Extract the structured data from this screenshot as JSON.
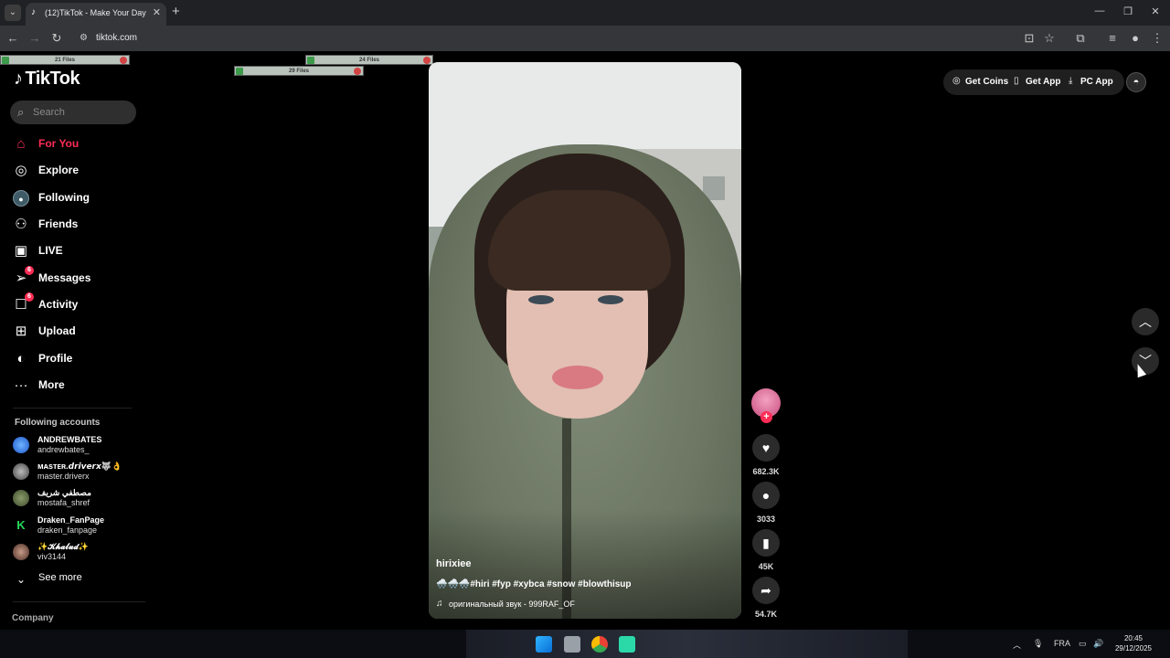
{
  "browser": {
    "tab_title": "(12)TikTok - Make Your Day",
    "url": "tiktok.com"
  },
  "file_bars": [
    "21 Files",
    "24 Files",
    "29 Files"
  ],
  "sidebar": {
    "logo": "TikTok",
    "search_placeholder": "Search",
    "nav": [
      {
        "label": "For You",
        "icon": "home-icon",
        "active": true
      },
      {
        "label": "Explore",
        "icon": "compass-icon"
      },
      {
        "label": "Following",
        "icon": "following-avatar-icon"
      },
      {
        "label": "Friends",
        "icon": "friends-icon"
      },
      {
        "label": "LIVE",
        "icon": "live-icon"
      },
      {
        "label": "Messages",
        "icon": "messages-icon",
        "badge": "6"
      },
      {
        "label": "Activity",
        "icon": "activity-icon",
        "badge": "6"
      },
      {
        "label": "Upload",
        "icon": "upload-icon"
      },
      {
        "label": "Profile",
        "icon": "profile-icon"
      },
      {
        "label": "More",
        "icon": "more-icon"
      }
    ],
    "following_title": "Following accounts",
    "accounts": [
      {
        "name": "ANDREWBATES",
        "handle": "andrewbates_"
      },
      {
        "name": "ᴍᴀsᴛᴇʀ.𝙙𝙧𝙞𝙫𝙚𝙧𝙭🐺👌",
        "handle": "master.driverx"
      },
      {
        "name": "مصطفي شريف",
        "handle": "mostafa_shref"
      },
      {
        "name": "Draken_FanPage",
        "handle": "draken_fanpage"
      },
      {
        "name": "✨𝓚𝓱𝓪𝓵𝓾𝓭✨",
        "handle": "viv3144"
      }
    ],
    "see_more": "See more",
    "company": "Company"
  },
  "video": {
    "author": "hirixiee",
    "caption": "🌨️🌨️🌨️#hiri #fyp #xybca #snow #blowthisup",
    "music": "оригинальный звук - 999RAF_OF"
  },
  "actions": {
    "likes": "682.3K",
    "comments": "3033",
    "saves": "45K",
    "shares": "54.7K"
  },
  "top_actions": {
    "coins": "Get Coins",
    "app": "Get App",
    "pc_app": "PC App"
  },
  "taskbar": {
    "lang": "FRA",
    "time": "20:45",
    "date": "29/12/2025"
  },
  "colors": {
    "accent": "#fe2c55",
    "background": "#000000"
  }
}
